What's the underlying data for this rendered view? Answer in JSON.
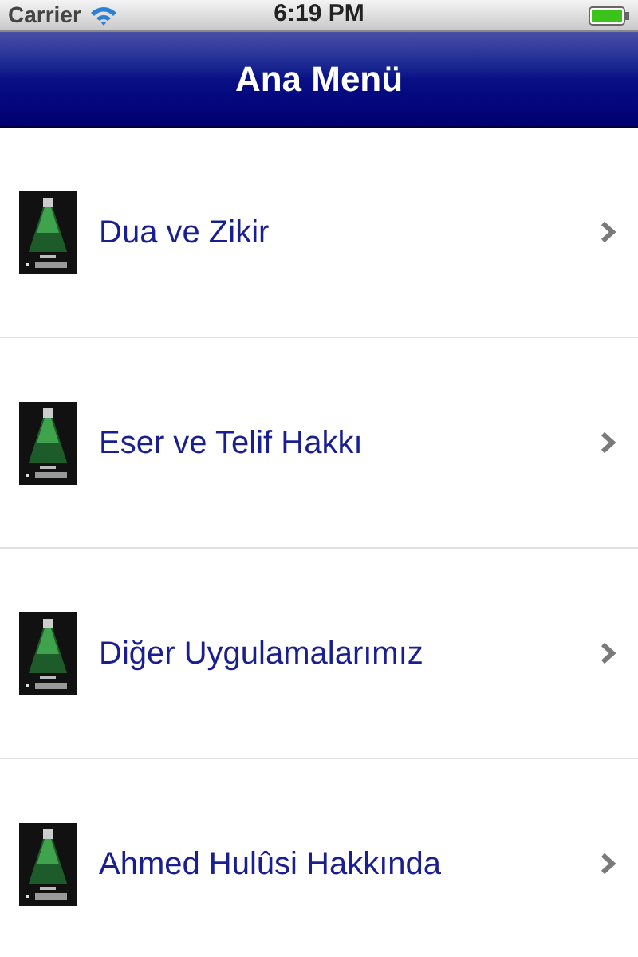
{
  "status_bar": {
    "carrier": "Carrier",
    "time": "6:19 PM"
  },
  "nav_bar": {
    "title": "Ana Menü"
  },
  "menu_items": [
    {
      "label": "Dua ve Zikir"
    },
    {
      "label": "Eser ve Telif Hakkı"
    },
    {
      "label": "Diğer Uygulamalarımız"
    },
    {
      "label": "Ahmed Hulûsi Hakkında"
    }
  ]
}
